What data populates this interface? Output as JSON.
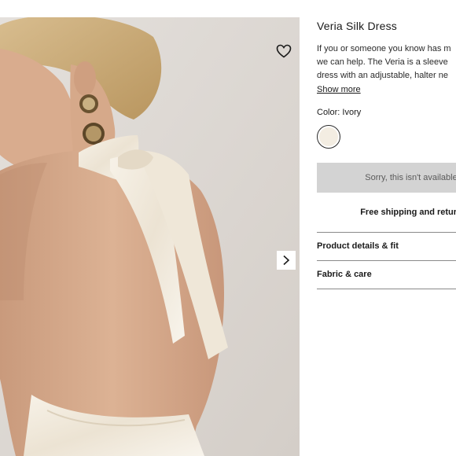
{
  "product": {
    "title": "Veria Silk Dress",
    "description_lines": [
      "If you or someone you know has m",
      "we can help. The Veria is a sleeve",
      "dress with an adjustable, halter ne"
    ],
    "show_more_label": "Show more"
  },
  "color": {
    "label": "Color: Ivory",
    "swatch_hex": "#f3ede2"
  },
  "actions": {
    "unavailable_label": "Sorry, this isn't available",
    "shipping_label": "Free shipping and return"
  },
  "accordions": [
    {
      "label": "Product details & fit"
    },
    {
      "label": "Fabric & care"
    }
  ],
  "icons": {
    "wishlist": "heart-outline-icon",
    "next": "chevron-right-icon"
  },
  "colors": {
    "background": "#ffffff",
    "photo_backdrop": "#ddd8d3",
    "disabled_button": "#d3d3d3",
    "divider": "#8a8a8a",
    "text": "#1a1a1a"
  }
}
